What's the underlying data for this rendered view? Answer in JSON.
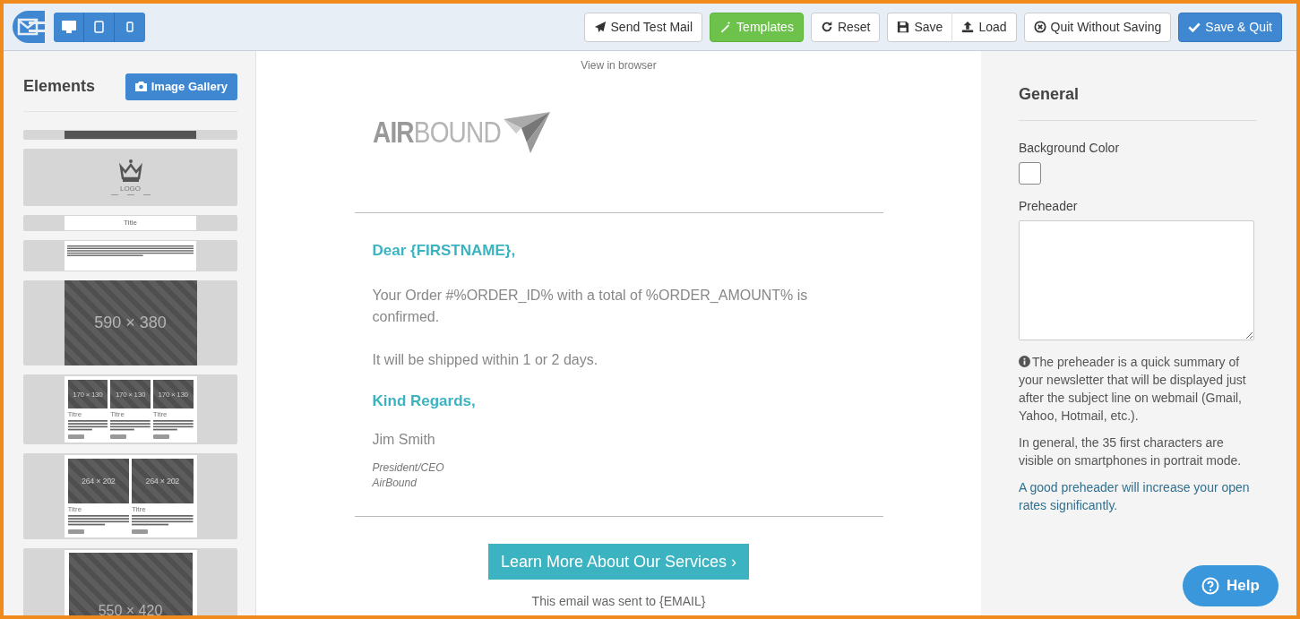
{
  "toolbar": {
    "device_buttons": [
      {
        "kind": "desktop"
      },
      {
        "kind": "tablet"
      },
      {
        "kind": "phone"
      }
    ],
    "action_groups": [
      {
        "buttons": [
          {
            "label": "Send Test Mail",
            "kind": "send"
          }
        ]
      },
      {
        "buttons": [
          {
            "label": "Templates",
            "kind": "templates"
          }
        ]
      },
      {
        "buttons": [
          {
            "label": "Reset",
            "kind": "reset"
          }
        ]
      },
      {
        "buttons": [
          {
            "label": "Save",
            "kind": "save"
          },
          {
            "label": "Load",
            "kind": "load"
          }
        ]
      },
      {
        "buttons": [
          {
            "label": "Quit Without Saving",
            "kind": "quit"
          }
        ]
      },
      {
        "buttons": [
          {
            "label": "Save & Quit",
            "kind": "savequit"
          }
        ]
      }
    ]
  },
  "sidebar": {
    "title": "Elements",
    "gallery_button": "Image Gallery",
    "blocks": [
      {
        "kind": "nav"
      },
      {
        "kind": "logo",
        "label": "LOGO"
      },
      {
        "kind": "title",
        "label": "Title"
      },
      {
        "kind": "text"
      },
      {
        "kind": "image",
        "label": "590 × 380"
      },
      {
        "kind": "columns",
        "items": [
          {
            "size": "170 × 130",
            "title": "Titre"
          },
          {
            "size": "170 × 130",
            "title": "Titre"
          },
          {
            "size": "170 × 130",
            "title": "Titre"
          }
        ]
      },
      {
        "kind": "columns",
        "items": [
          {
            "size": "264 × 202",
            "title": "Titre"
          },
          {
            "size": "264 × 202",
            "title": "Titre"
          }
        ]
      },
      {
        "kind": "image",
        "label": "550 × 420"
      }
    ]
  },
  "email": {
    "view_in_browser": "View in browser",
    "logo_text": "**AIR**BOUND",
    "greeting": "Dear {FIRSTNAME},",
    "paragraphs": [
      "Your Order #%ORDER_ID% with a total of %ORDER_AMOUNT% is confirmed.",
      "It will be shipped within 1 or 2 days."
    ],
    "closing": "Kind Regards,",
    "signature_name": "Jim Smith",
    "signature_lines": [
      "President/CEO",
      "AirBound"
    ],
    "cta": "Learn More About Our Services ›",
    "footer": "This email was sent to {EMAIL}"
  },
  "settings": {
    "title": "General",
    "background_color_label": "Background Color",
    "preheader_label": "Preheader",
    "notes": [
      {
        "kind": "info",
        "text": "The preheader is a quick summary of your newsletter that will be displayed just after the subject line on webmail (Gmail, Yahoo, Hotmail, etc.)."
      },
      {
        "kind": "plain",
        "text": "In general, the 35 first characters are visible on smartphones in portrait mode."
      },
      {
        "kind": "highlight",
        "text": "A good preheader will increase your open rates significantly."
      }
    ]
  },
  "help_button": "Help"
}
